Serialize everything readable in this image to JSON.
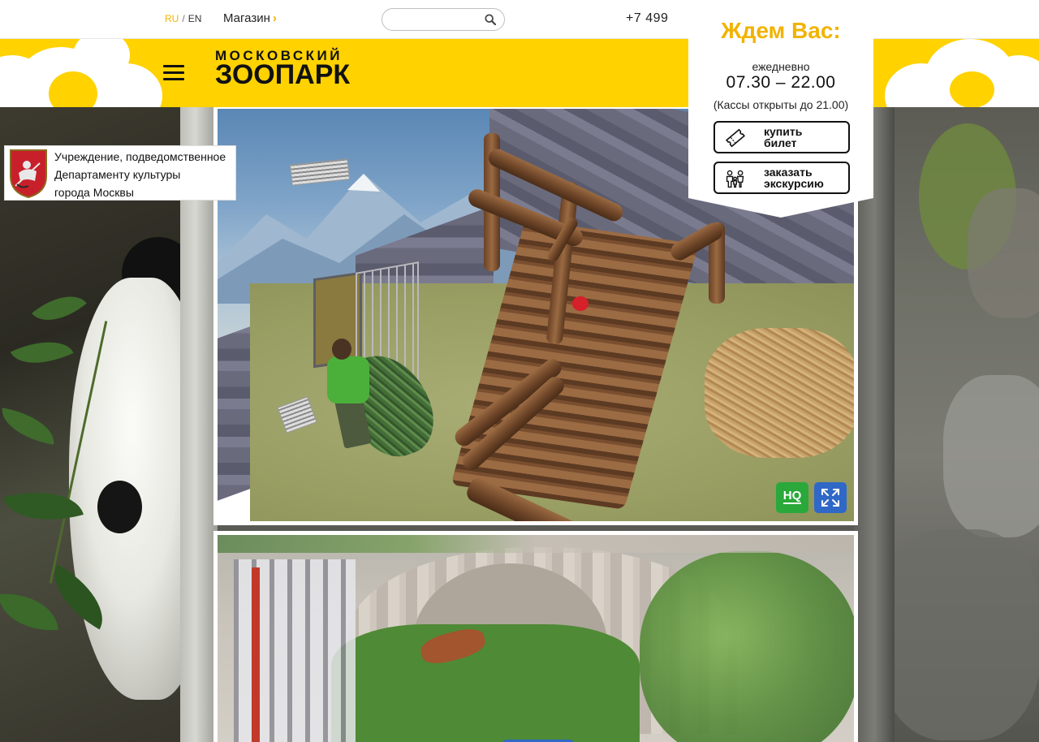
{
  "topbar": {
    "lang_ru": "RU",
    "lang_sep": "/",
    "lang_en": "EN",
    "shop_label": "Магазин",
    "shop_chevron": "›",
    "search_placeholder": "",
    "phone": "+7 499"
  },
  "header": {
    "logo_line1": "МОСКОВСКИЙ",
    "logo_line2": "ЗООПАРК",
    "menu_icon": "hamburger-icon",
    "accent_color": "#ffd200"
  },
  "gov_badge": {
    "line1": "Учреждение, подведомственное",
    "line2": "Департаменту культуры",
    "line3": "города Москвы",
    "emblem_icon": "moscow-coat-of-arms"
  },
  "hours": {
    "title": "Ждем Вас:",
    "daily": "ежедневно",
    "time": "07.30 – 22.00",
    "cash_note": "(Кассы открыты до 21.00)",
    "buy_ticket": "купить\nбилет",
    "book_tour": "заказать\nэкскурсию",
    "title_color": "#f2b300"
  },
  "video1": {
    "hq_label": "HQ",
    "fullscreen_icon": "fullscreen-icon",
    "hq_color": "#2aa83a",
    "fs_color": "#2f68c6"
  }
}
